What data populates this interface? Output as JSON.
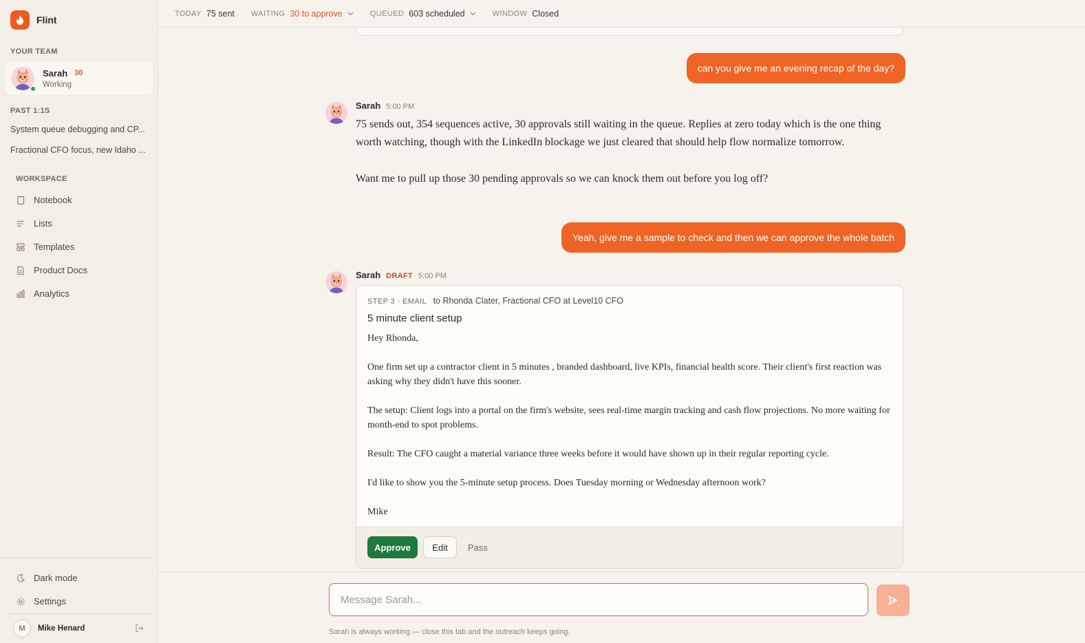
{
  "app": {
    "name": "Flint"
  },
  "colors": {
    "accent": "#ef6424",
    "approve": "#1e7a3c",
    "online": "#2ea043"
  },
  "sidebar": {
    "team_label": "YOUR TEAM",
    "team_member": {
      "name": "Sarah",
      "count": "30",
      "status": "Working"
    },
    "past_label": "PAST 1:1S",
    "past_items": [
      "System queue debugging and CP...",
      "Fractional CFO focus, new Idaho ..."
    ],
    "workspace_label": "WORKSPACE",
    "workspace_items": [
      {
        "label": "Notebook",
        "icon": "notebook-icon"
      },
      {
        "label": "Lists",
        "icon": "lists-icon"
      },
      {
        "label": "Templates",
        "icon": "templates-icon"
      },
      {
        "label": "Product Docs",
        "icon": "document-icon"
      },
      {
        "label": "Analytics",
        "icon": "analytics-icon"
      }
    ],
    "dark_mode_label": "Dark mode",
    "settings_label": "Settings",
    "user": {
      "initial": "M",
      "name": "Mike Henard"
    }
  },
  "topbar": {
    "today": {
      "label": "TODAY",
      "value": "75 sent"
    },
    "waiting": {
      "label": "WAITING",
      "value": "30 to approve"
    },
    "queued": {
      "label": "QUEUED",
      "value": "603 scheduled"
    },
    "window": {
      "label": "WINDOW",
      "value": "Closed"
    }
  },
  "chat": {
    "user_msg_1": "can you give me an evening recap of the day?",
    "reply_1": {
      "name": "Sarah",
      "time": "5:00 PM",
      "para_1": "75 sends out, 354 sequences active, 30 approvals still waiting in the queue. Replies at zero today which is the one thing worth watching, though with the LinkedIn blockage we just cleared that should help flow normalize tomorrow.",
      "para_2": "Want me to pull up those 30 pending approvals so we can knock them out before you log off?"
    },
    "user_msg_2": "Yeah, give me a sample to check and then we can approve the whole batch",
    "reply_2": {
      "name": "Sarah",
      "badge": "DRAFT",
      "time": "5:00 PM",
      "draft": {
        "step": "STEP 3 · EMAIL",
        "recipient": "to Rhonda Clater, Fractional CFO at Level10 CFO",
        "subject": "5 minute client setup",
        "greeting": "Hey Rhonda,",
        "para_1": "One firm set up a contractor client in 5 minutes ,  branded dashboard, live KPIs, financial health score. Their client's first reaction was asking why they didn't have this sooner.",
        "para_2": "The setup: Client logs into a portal on the firm's website, sees real-time margin tracking and cash flow projections. No more waiting for month-end to spot problems.",
        "para_3": "Result: The CFO caught a material variance three weeks before it would have shown up in their regular reporting cycle.",
        "para_4": "I'd like to show you the 5-minute setup process. Does Tuesday morning or Wednesday afternoon work?",
        "signoff": "Mike",
        "approve_label": "Approve",
        "edit_label": "Edit",
        "pass_label": "Pass"
      }
    }
  },
  "composer": {
    "placeholder": "Message Sarah...",
    "footnote": "Sarah is always working — close this tab and the outreach keeps going."
  }
}
